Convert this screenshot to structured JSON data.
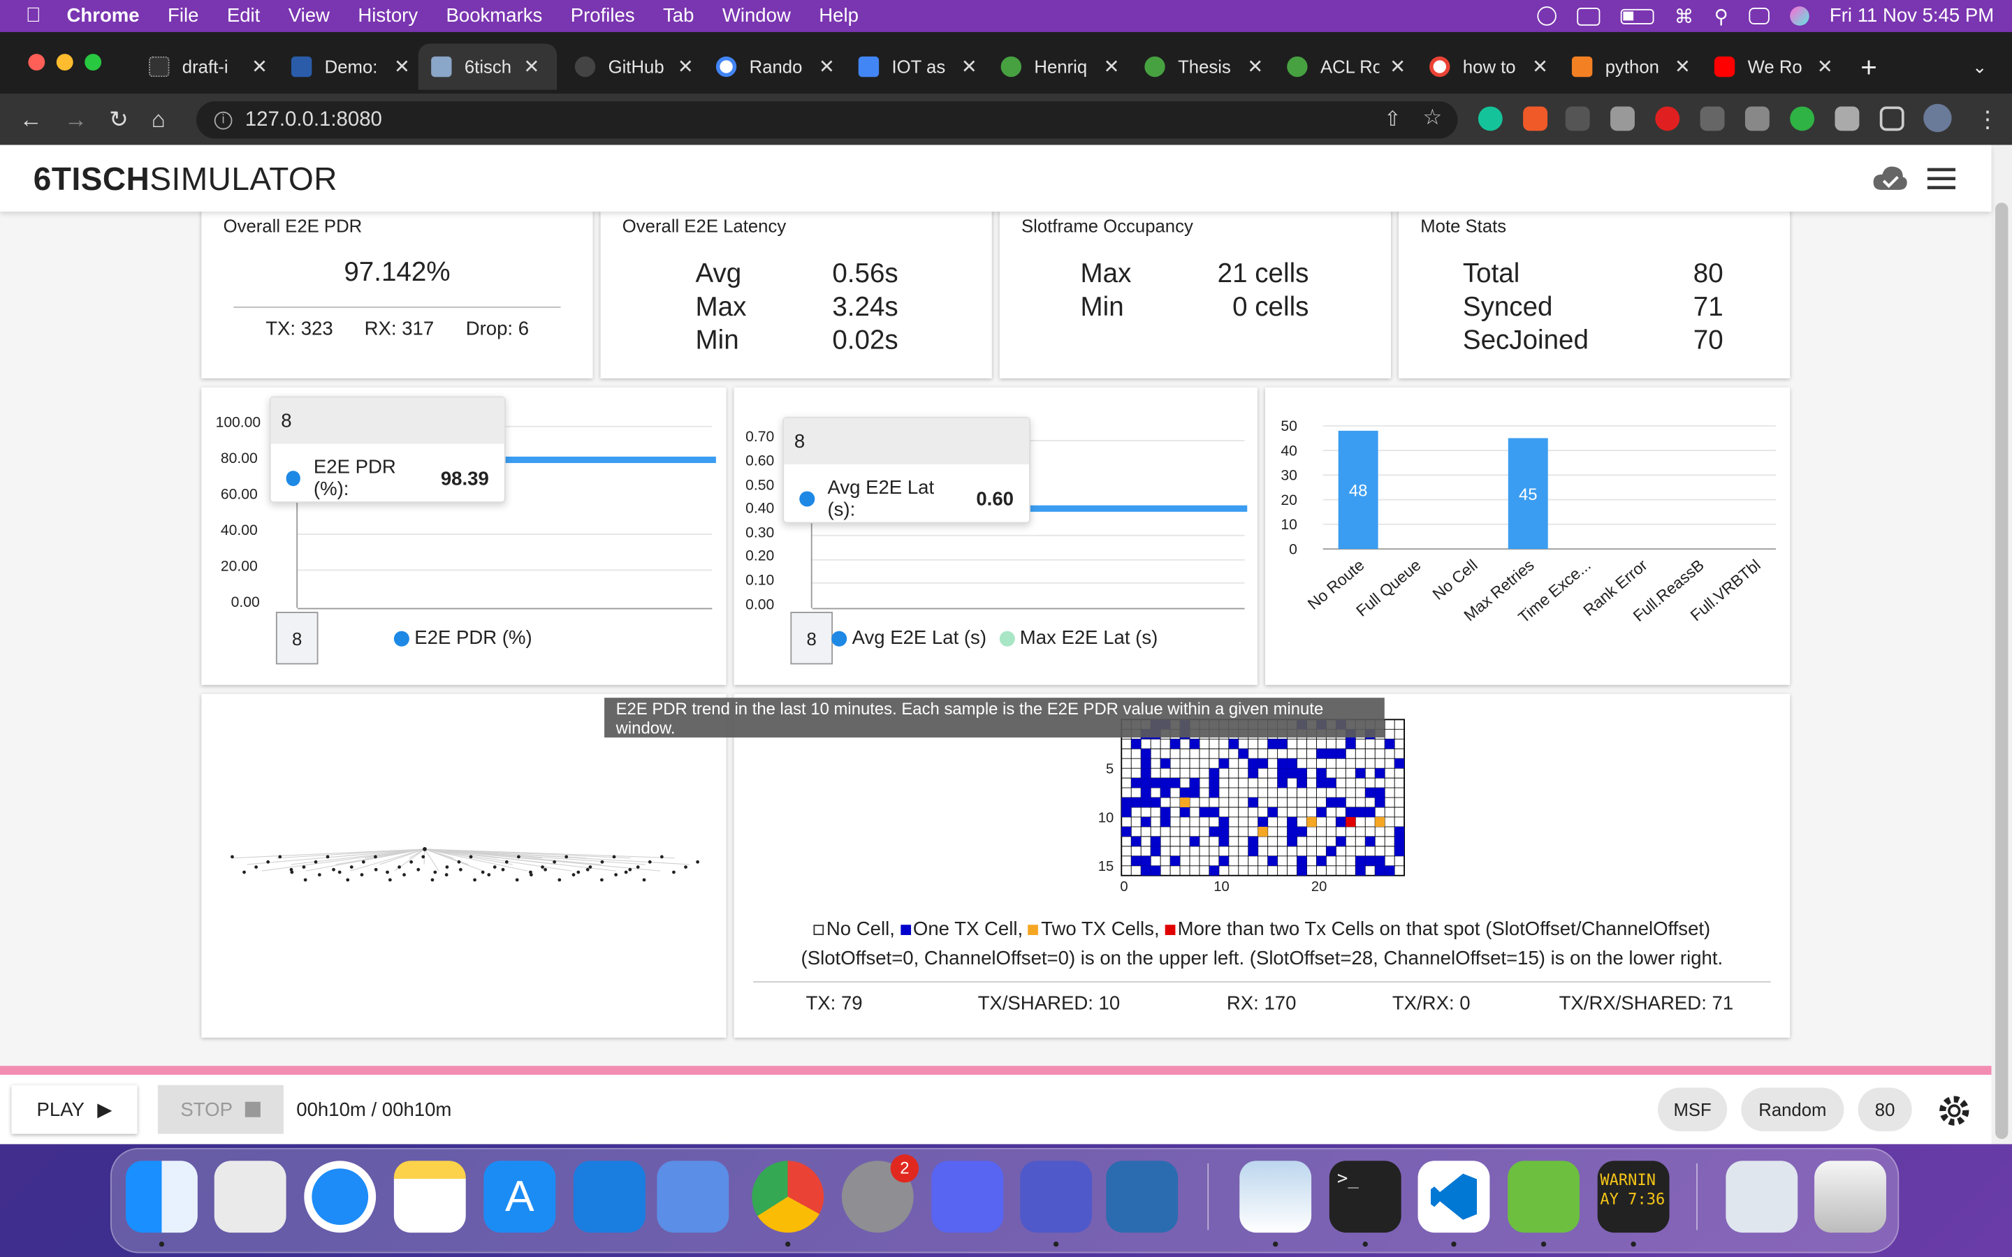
{
  "menubar": {
    "app": "Chrome",
    "items": [
      "File",
      "Edit",
      "View",
      "History",
      "Bookmarks",
      "Profiles",
      "Tab",
      "Window",
      "Help"
    ],
    "clock": "Fri 11 Nov  5:45 PM"
  },
  "tabs": [
    {
      "title": "draft-i",
      "icon": "draft-favicon"
    },
    {
      "title": "Demo:",
      "icon": "ieee-favicon"
    },
    {
      "title": "6tisch",
      "icon": "6tisch-favicon"
    },
    {
      "title": "GitHub",
      "icon": "github-favicon"
    },
    {
      "title": "Rando",
      "icon": "google-favicon"
    },
    {
      "title": "IOT as",
      "icon": "docs-favicon"
    },
    {
      "title": "Henriq",
      "icon": "overleaf-favicon"
    },
    {
      "title": "Thesis",
      "icon": "overleaf-favicon"
    },
    {
      "title": "ACL Ro",
      "icon": "overleaf-favicon"
    },
    {
      "title": "how to",
      "icon": "google-favicon"
    },
    {
      "title": "python",
      "icon": "stackoverflow-favicon"
    },
    {
      "title": "We Ro",
      "icon": "youtube-favicon"
    }
  ],
  "browser": {
    "url": "127.0.0.1:8080"
  },
  "app": {
    "logo_bold": "6TISCH",
    "logo_light": "SIMULATOR",
    "pdr": {
      "title": "Overall E2E PDR",
      "value": "97.142%",
      "tx": "TX: 323",
      "rx": "RX: 317",
      "drop": "Drop: 6"
    },
    "latency": {
      "title": "Overall E2E Latency",
      "rows": [
        {
          "label": "Avg",
          "value": "0.56s"
        },
        {
          "label": "Max",
          "value": "3.24s"
        },
        {
          "label": "Min",
          "value": "0.02s"
        }
      ]
    },
    "slotframe": {
      "title": "Slotframe Occupancy",
      "rows": [
        {
          "label": "Max",
          "value": "21 cells"
        },
        {
          "label": "Min",
          "value": "0 cells"
        }
      ]
    },
    "mote": {
      "title": "Mote Stats",
      "rows": [
        {
          "label": "Total",
          "value": "80"
        },
        {
          "label": "Synced",
          "value": "71"
        },
        {
          "label": "SecJoined",
          "value": "70"
        }
      ]
    },
    "pdr_chart": {
      "yticks": [
        "100.00",
        "80.00",
        "60.00",
        "40.00",
        "20.00",
        "0.00"
      ],
      "tooltip_title": "8",
      "tooltip_label": "E2E PDR (%):",
      "tooltip_value": "98.39",
      "x_marker": "8",
      "legend": "E2E PDR (%)"
    },
    "lat_chart": {
      "yticks": [
        "0.70",
        "0.60",
        "0.50",
        "0.40",
        "0.30",
        "0.20",
        "0.10",
        "0.00"
      ],
      "tooltip_title": "8",
      "tooltip_label": "Avg E2E Lat (s):",
      "tooltip_value": "0.60",
      "x_marker": "8",
      "legend_avg": "Avg E2E Lat (s)",
      "legend_max": "Max E2E Lat (s)"
    },
    "drops_chart": {
      "yticks": [
        "50",
        "40",
        "30",
        "20",
        "10",
        "0"
      ]
    },
    "tooltip_text": "E2E PDR trend in the last 10 minutes. Each sample is the E2E PDR value within a given minute window.",
    "grid": {
      "y_ticks": [
        "5",
        "10",
        "15"
      ],
      "x_ticks": [
        "0",
        "10",
        "20"
      ],
      "legend_no": "No Cell,",
      "legend_one": "One TX Cell,",
      "legend_two": "Two TX Cells,",
      "legend_more": "More than two Tx Cells on that spot (SlotOffset/ChannelOffset)",
      "note": "(SlotOffset=0, ChannelOffset=0) is on the upper left. (SlotOffset=28, ChannelOffset=15) is on the lower right.",
      "stats": [
        "TX: 79",
        "TX/SHARED: 10",
        "RX: 170",
        "TX/RX: 0",
        "TX/RX/SHARED: 71"
      ]
    },
    "footer": {
      "play": "PLAY",
      "stop": "STOP",
      "time": "00h10m / 00h10m",
      "chips": [
        "MSF",
        "Random",
        "80"
      ]
    }
  },
  "chart_data": {
    "type": "bar",
    "categories": [
      "No Route",
      "Full Queue",
      "No Cell",
      "Max Retries",
      "Time Exce...",
      "Rank Error",
      "Full.ReassB",
      "Full.VRBTbl"
    ],
    "values": [
      48,
      0,
      0,
      45,
      0,
      0,
      0,
      0
    ],
    "ylim": [
      0,
      50
    ]
  },
  "colors": {
    "accent": "#3b9df1",
    "one_tx": "#0000cc",
    "two_tx": "#f5a623",
    "more_tx": "#e00000",
    "footer_bar": "#f28db1"
  },
  "dock": {
    "settings_badge": "2",
    "console_text": "WARNIN\nAY 7:36"
  }
}
